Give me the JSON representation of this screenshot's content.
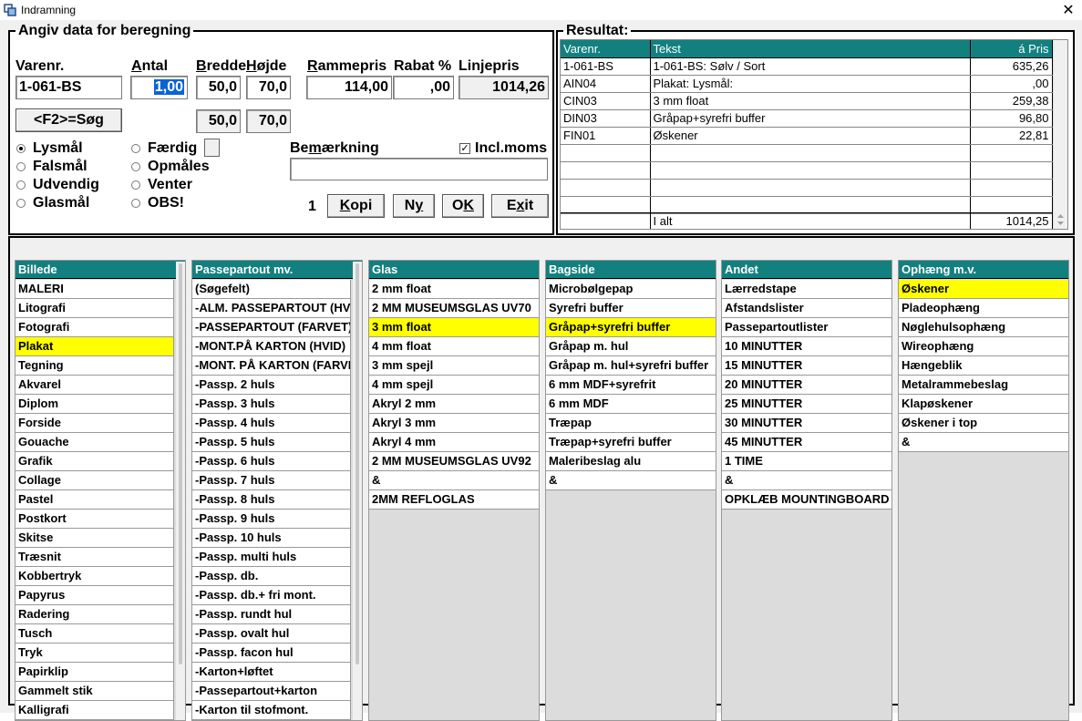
{
  "window": {
    "title": "Indramning",
    "close_glyph": "✕"
  },
  "input_group": {
    "legend": "Angiv data for beregning",
    "labels": {
      "varenr": "Varenr.",
      "antal_pre": "",
      "antal_u": "A",
      "antal_post": "ntal",
      "bredde_u": "B",
      "bredde_post": "redde",
      "hojde_u": "H",
      "hojde_post": "øjde",
      "rammepris_u": "R",
      "rammepris_post": "ammepris",
      "rabat": "Rabat %",
      "linjepris": "Linjepris"
    },
    "values": {
      "varenr": "1-061-BS",
      "antal": "1,00",
      "bredde": "50,0",
      "hojde": "70,0",
      "rammepris": "114,00",
      "rabat": ",00",
      "linjepris": "1014,26",
      "bredde2": "50,0",
      "hojde2": "70,0"
    },
    "search_button": "<F2>=Søg",
    "radios_left": [
      {
        "label": "Lysmål",
        "checked": true
      },
      {
        "label": "Falsmål",
        "checked": false
      },
      {
        "label": "Udvendig",
        "checked": false
      },
      {
        "label": "Glasmål",
        "checked": false
      }
    ],
    "radios_right": [
      {
        "label": "Færdig",
        "checked": false
      },
      {
        "label": "Opmåles",
        "checked": false
      },
      {
        "label": "Venter",
        "checked": false
      },
      {
        "label": "OBS!",
        "checked": false
      }
    ],
    "bemaerkning_pre": "Be",
    "bemaerkning_u": "m",
    "bemaerkning_post": "ærkning",
    "bemaerkning_value": "",
    "incl_moms_label": "Incl.moms",
    "incl_moms_checked": true,
    "count": "1",
    "buttons": {
      "kopi_u": "K",
      "kopi_post": "opi",
      "ny_pre": "N",
      "ny_u": "y",
      "ok_pre": "O",
      "ok_u": "K",
      "exit_pre": "E",
      "exit_u": "x",
      "exit_post": "it"
    }
  },
  "result": {
    "legend": "Resultat:",
    "columns": {
      "varenr": "Varenr.",
      "tekst": "Tekst",
      "pris": "á Pris"
    },
    "rows": [
      {
        "varenr": "1-061-BS",
        "tekst": "1-061-BS:  Sølv / Sort",
        "pris": "635,26"
      },
      {
        "varenr": "AIN04",
        "tekst": "Plakat:  Lysmål:",
        "pris": ",00"
      },
      {
        "varenr": "CIN03",
        "tekst": "3 mm float",
        "pris": "259,38"
      },
      {
        "varenr": "DIN03",
        "tekst": "Gråpap+syrefri buffer",
        "pris": "96,80"
      },
      {
        "varenr": "FIN01",
        "tekst": "Øskener",
        "pris": "22,81"
      },
      {
        "varenr": "",
        "tekst": "",
        "pris": ""
      },
      {
        "varenr": "",
        "tekst": "",
        "pris": ""
      },
      {
        "varenr": "",
        "tekst": "",
        "pris": ""
      },
      {
        "varenr": "",
        "tekst": "",
        "pris": ""
      }
    ],
    "total": {
      "label": "I alt",
      "value": "1014,25"
    }
  },
  "categories": [
    {
      "header": "Billede",
      "selected": 3,
      "items": [
        "MALERI",
        "Litografi",
        "Fotografi",
        "Plakat",
        "Tegning",
        "Akvarel",
        "Diplom",
        "Forside",
        "Gouache",
        "Grafik",
        "Collage",
        "Pastel",
        "Postkort",
        "Skitse",
        "Træsnit",
        "Kobbertryk",
        "Papyrus",
        "Radering",
        "Tusch",
        "Tryk",
        "Papirklip",
        "Gammelt stik",
        "Kalligrafi"
      ]
    },
    {
      "header": "Passepartout mv.",
      "selected": -1,
      "items": [
        "(Søgefelt)",
        "-ALM. PASSEPARTOUT (HVID)",
        "-PASSEPARTOUT (FARVET)",
        "-MONT.PÅ KARTON (HVID)",
        "-MONT. PÅ KARTON (FARVET)",
        "-Passp. 2 huls",
        "-Passp. 3 huls",
        "-Passp. 4 huls",
        "-Passp. 5 huls",
        "-Passp. 6 huls",
        "-Passp. 7 huls",
        "-Passp. 8 huls",
        "-Passp. 9 huls",
        "-Passp. 10 huls",
        "-Passp. multi huls",
        "-Passp. db.",
        "-Passp. db.+ fri mont.",
        "-Passp. rundt hul",
        "-Passp. ovalt hul",
        "-Passp. facon hul",
        "-Karton+løftet",
        "-Passepartout+karton",
        "-Karton til stofmont."
      ]
    },
    {
      "header": "Glas",
      "selected": 2,
      "items": [
        "2 mm float",
        "2 MM MUSEUMSGLAS UV70",
        "3 mm float",
        "4 mm float",
        "3 mm spejl",
        "4 mm spejl",
        "Akryl 2 mm",
        "Akryl 3 mm",
        "Akryl 4 mm",
        "2 MM MUSEUMSGLAS UV92",
        "&",
        "2MM REFLOGLAS"
      ]
    },
    {
      "header": "Bagside",
      "selected": 2,
      "items": [
        "Microbølgepap",
        "Syrefri buffer",
        "Gråpap+syrefri buffer",
        "Gråpap m. hul",
        "Gråpap m. hul+syrefri buffer",
        "6 mm MDF+syrefrit",
        "6 mm MDF",
        "Træpap",
        "Træpap+syrefri buffer",
        "Maleribeslag alu",
        "&"
      ]
    },
    {
      "header": "Andet",
      "selected": -1,
      "items": [
        "Lærredstape",
        "Afstandslister",
        "Passepartoutlister",
        "10 MINUTTER",
        "15 MINUTTER",
        "20 MINUTTER",
        "25 MINUTTER",
        "30 MINUTTER",
        "45 MINUTTER",
        "1 TIME",
        "&",
        "OPKLÆB MOUNTINGBOARD"
      ]
    },
    {
      "header": "Ophæng m.v.",
      "selected": 0,
      "items": [
        "Øskener",
        "Pladeophæng",
        "Nøglehulsophæng",
        "Wireophæng",
        "Hængeblik",
        "Metalrammebeslag",
        "Klapøskener",
        "Øskener i top",
        "&"
      ]
    }
  ],
  "colors": {
    "header_teal": "#138080",
    "selection_yellow": "#ffff00"
  }
}
